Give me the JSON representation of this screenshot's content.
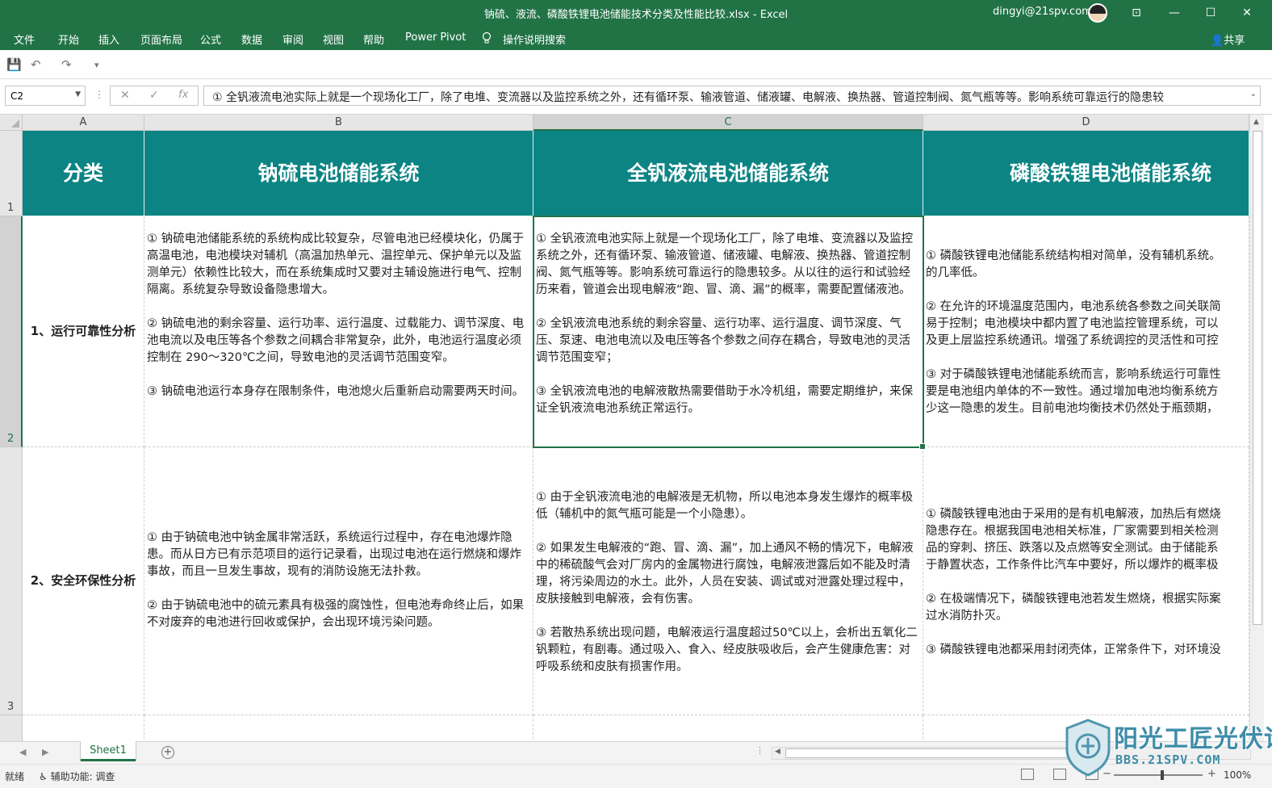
{
  "window": {
    "title": "钠硫、液流、磷酸铁锂电池储能技术分类及性能比较.xlsx  -  Excel",
    "account": "dingyi@21spv.com",
    "controls": {
      "ribbon_display": "⊡",
      "minimize": "—",
      "maximize": "☐",
      "close": "✕"
    }
  },
  "ribbon": {
    "tabs": [
      "文件",
      "开始",
      "插入",
      "页面布局",
      "公式",
      "数据",
      "审阅",
      "视图",
      "帮助",
      "Power Pivot"
    ],
    "tell_me": "操作说明搜索",
    "share": "共享"
  },
  "qat": {
    "save": "💾",
    "undo": "↶",
    "redo": "↷",
    "customize": "▾"
  },
  "formula_bar": {
    "name_box": "C2",
    "cancel": "✕",
    "enter": "✓",
    "fx": "fx",
    "value": "① 全钒液流电池实际上就是一个现场化工厂，除了电堆、变流器以及监控系统之外，还有循环泵、输液管道、储液罐、电解液、换热器、管道控制阀、氮气瓶等等。影响系统可靠运行的隐患较"
  },
  "grid": {
    "columns": [
      "A",
      "B",
      "C",
      "D"
    ],
    "rows": [
      "1",
      "2",
      "3"
    ],
    "header_color": "#0d8484",
    "header_row": [
      "分类",
      "钠硫电池储能系统",
      "全钒液流电池储能系统",
      "磷酸铁锂电池储能系统"
    ],
    "row2": {
      "category": "1、运行可靠性分析",
      "b": "① 钠硫电池储能系统的系统构成比较复杂，尽管电池已经模块化，仍属于高温电池，电池模块对辅机（高温加热单元、温控单元、保护单元以及监测单元）依赖性比较大，而在系统集成时又要对主辅设施进行电气、控制隔离。系统复杂导致设备隐患增大。\n\n② 钠硫电池的剩余容量、运行功率、运行温度、过载能力、调节深度、电池电流以及电压等各个参数之间耦合非常复杂，此外，电池运行温度必须控制在 290～320℃之间，导致电池的灵活调节范围变窄。\n\n③ 钠硫电池运行本身存在限制条件，电池熄火后重新启动需要两天时间。",
      "c": "① 全钒液流电池实际上就是一个现场化工厂，除了电堆、变流器以及监控系统之外，还有循环泵、输液管道、储液罐、电解液、换热器、管道控制阀、氮气瓶等等。影响系统可靠运行的隐患较多。从以往的运行和试验经历来看，管道会出现电解液“跑、冒、滴、漏”的概率，需要配置储液池。\n\n② 全钒液流电池系统的剩余容量、运行功率、运行温度、调节深度、气压、泵速、电池电流以及电压等各个参数之间存在耦合，导致电池的灵活调节范围变窄；\n\n③ 全钒液流电池的电解液散热需要借助于水冷机组，需要定期维护，来保证全钒液流电池系统正常运行。",
      "d": "① 磷酸铁锂电池储能系统结构相对简单，没有辅机系统。\n的几率低。\n\n② 在允许的环境温度范围内，电池系统各参数之间关联简\n易于控制；电池模块中都内置了电池监控管理系统，可以\n及更上层监控系统通讯。增强了系统调控的灵活性和可控\n\n③ 对于磷酸铁锂电池储能系统而言，影响系统运行可靠性\n要是电池组内单体的不一致性。通过增加电池均衡系统方\n少这一隐患的发生。目前电池均衡技术仍然处于瓶颈期，"
    },
    "row3": {
      "category": "2、安全环保性分析",
      "b": "① 由于钠硫电池中钠金属非常活跃，系统运行过程中，存在电池爆炸隐患。而从日方已有示范项目的运行记录看，出现过电池在运行燃烧和爆炸事故，而且一旦发生事故，现有的消防设施无法扑救。\n\n② 由于钠硫电池中的硫元素具有极强的腐蚀性，但电池寿命终止后，如果不对废弃的电池进行回收或保护，会出现环境污染问题。",
      "c": "① 由于全钒液流电池的电解液是无机物，所以电池本身发生爆炸的概率极低（辅机中的氮气瓶可能是一个小隐患）。\n\n② 如果发生电解液的“跑、冒、滴、漏”，加上通风不畅的情况下，电解液中的稀硫酸气会对厂房内的金属物进行腐蚀，电解液泄露后如不能及时清理，将污染周边的水土。此外，人员在安装、调试或对泄露处理过程中，皮肤接触到电解液，会有伤害。\n\n③ 若散热系统出现问题，电解液运行温度超过50℃以上，会析出五氧化二钒颗粒，有剧毒。通过吸入、食入、经皮肤吸收后，会产生健康危害：对呼吸系统和皮肤有损害作用。",
      "d": "① 磷酸铁锂电池由于采用的是有机电解液，加热后有燃烧\n隐患存在。根据我国电池相关标准，厂家需要到相关检测\n品的穿刺、挤压、跌落以及点燃等安全测试。由于储能系\n于静置状态，工作条件比汽车中要好，所以爆炸的概率极\n\n② 在极端情况下，磷酸铁锂电池若发生燃烧，根据实际案\n过水消防扑灭。\n\n③ 磷酸铁锂电池都采用封闭壳体，正常条件下，对环境没"
    }
  },
  "sheets": {
    "tabs": [
      "Sheet1"
    ],
    "add": "+",
    "prev": "◀",
    "next": "▶"
  },
  "status": {
    "ready": "就绪",
    "accessibility": "辅助功能: 调查",
    "zoom": "100%",
    "zoom_out": "−",
    "zoom_in": "+"
  },
  "watermark": {
    "brand": "阳光工匠光伏论坛",
    "url": "BBS.21SPV.COM"
  }
}
